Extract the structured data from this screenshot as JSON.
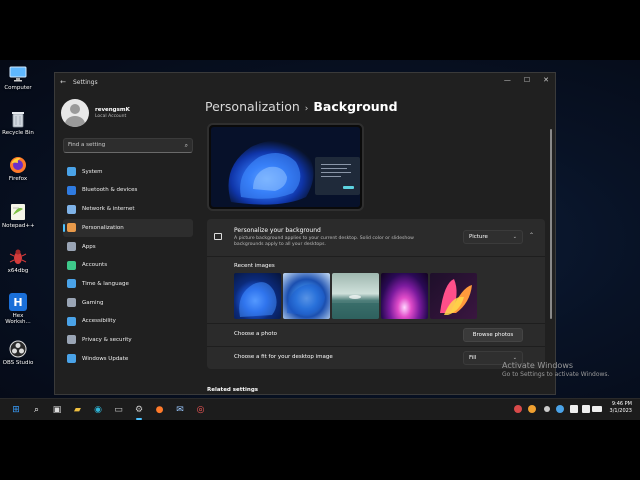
{
  "desktop_icons": [
    {
      "label": "Computer",
      "icon": "monitor-icon"
    },
    {
      "label": "Recycle Bin",
      "icon": "recycle-bin-icon"
    },
    {
      "label": "Firefox",
      "icon": "firefox-icon"
    },
    {
      "label": "Notepad++",
      "icon": "notepad-plus-plus-icon"
    },
    {
      "label": "x64dbg",
      "icon": "debugger-bug-icon"
    },
    {
      "label": "Hex Worksh...",
      "icon": "hex-workshop-icon"
    },
    {
      "label": "OBS Studio",
      "icon": "obs-studio-icon"
    }
  ],
  "window": {
    "title": "Settings",
    "back_glyph": "←",
    "minimize_glyph": "—",
    "maximize_glyph": "☐",
    "close_glyph": "✕"
  },
  "user": {
    "name": "revengsmK",
    "account_type": "Local Account"
  },
  "search": {
    "placeholder": "Find a setting",
    "glyph": "⌕"
  },
  "nav": [
    {
      "label": "System",
      "icon": "system-icon",
      "color": "#4aa3e8",
      "active": false
    },
    {
      "label": "Bluetooth & devices",
      "icon": "bluetooth-icon",
      "color": "#2f7be0",
      "active": false
    },
    {
      "label": "Network & internet",
      "icon": "wifi-icon",
      "color": "#7fb3e8",
      "active": false
    },
    {
      "label": "Personalization",
      "icon": "brush-icon",
      "color": "#e89a4a",
      "active": true
    },
    {
      "label": "Apps",
      "icon": "apps-icon",
      "color": "#9aa5b5",
      "active": false
    },
    {
      "label": "Accounts",
      "icon": "accounts-icon",
      "color": "#3ec98a",
      "active": false
    },
    {
      "label": "Time & language",
      "icon": "clock-globe-icon",
      "color": "#4aa3e8",
      "active": false
    },
    {
      "label": "Gaming",
      "icon": "controller-icon",
      "color": "#9aa5b5",
      "active": false
    },
    {
      "label": "Accessibility",
      "icon": "accessibility-icon",
      "color": "#4aa3e8",
      "active": false
    },
    {
      "label": "Privacy & security",
      "icon": "shield-icon",
      "color": "#9aa5b5",
      "active": false
    },
    {
      "label": "Windows Update",
      "icon": "update-icon",
      "color": "#4aa3e8",
      "active": false
    }
  ],
  "breadcrumb": {
    "parent": "Personalization",
    "separator": "›",
    "current": "Background"
  },
  "background_card": {
    "title": "Personalize your background",
    "description": "A picture background applies to your current desktop. Solid color or slideshow backgrounds apply to all your desktops.",
    "type_value": "Picture",
    "dropdown_glyph": "⌄",
    "collapse_glyph": "⌃",
    "recent_label": "Recent images",
    "choose_photo_label": "Choose a photo",
    "browse_label": "Browse photos",
    "fit_label": "Choose a fit for your desktop image",
    "fit_value": "Fill"
  },
  "related": "Related settings",
  "watermark": {
    "line1": "Activate Windows",
    "line2": "Go to Settings to activate Windows."
  },
  "taskbar": {
    "items": [
      {
        "icon": "windows-start-icon",
        "glyph": "⊞",
        "color": "#3aa0ff"
      },
      {
        "icon": "search-icon",
        "glyph": "⌕",
        "color": "#ffffff"
      },
      {
        "icon": "task-view-icon",
        "glyph": "▣",
        "color": "#dddddd"
      },
      {
        "icon": "file-explorer-icon",
        "glyph": "▰",
        "color": "#f0c040"
      },
      {
        "icon": "edge-icon",
        "glyph": "◉",
        "color": "#2fb6d8"
      },
      {
        "icon": "terminal-icon",
        "glyph": "▭",
        "color": "#cccccc"
      },
      {
        "icon": "settings-icon",
        "glyph": "⚙",
        "color": "#cccccc"
      },
      {
        "icon": "firefox-icon",
        "glyph": "●",
        "color": "#ff7a2a"
      },
      {
        "icon": "mail-icon",
        "glyph": "✉",
        "color": "#9ac8ff"
      },
      {
        "icon": "obs-icon",
        "glyph": "◎",
        "color": "#ff5a5a"
      }
    ],
    "active_index": 6
  },
  "clock": {
    "time": "9:46 PM",
    "date": "3/1/2023"
  }
}
